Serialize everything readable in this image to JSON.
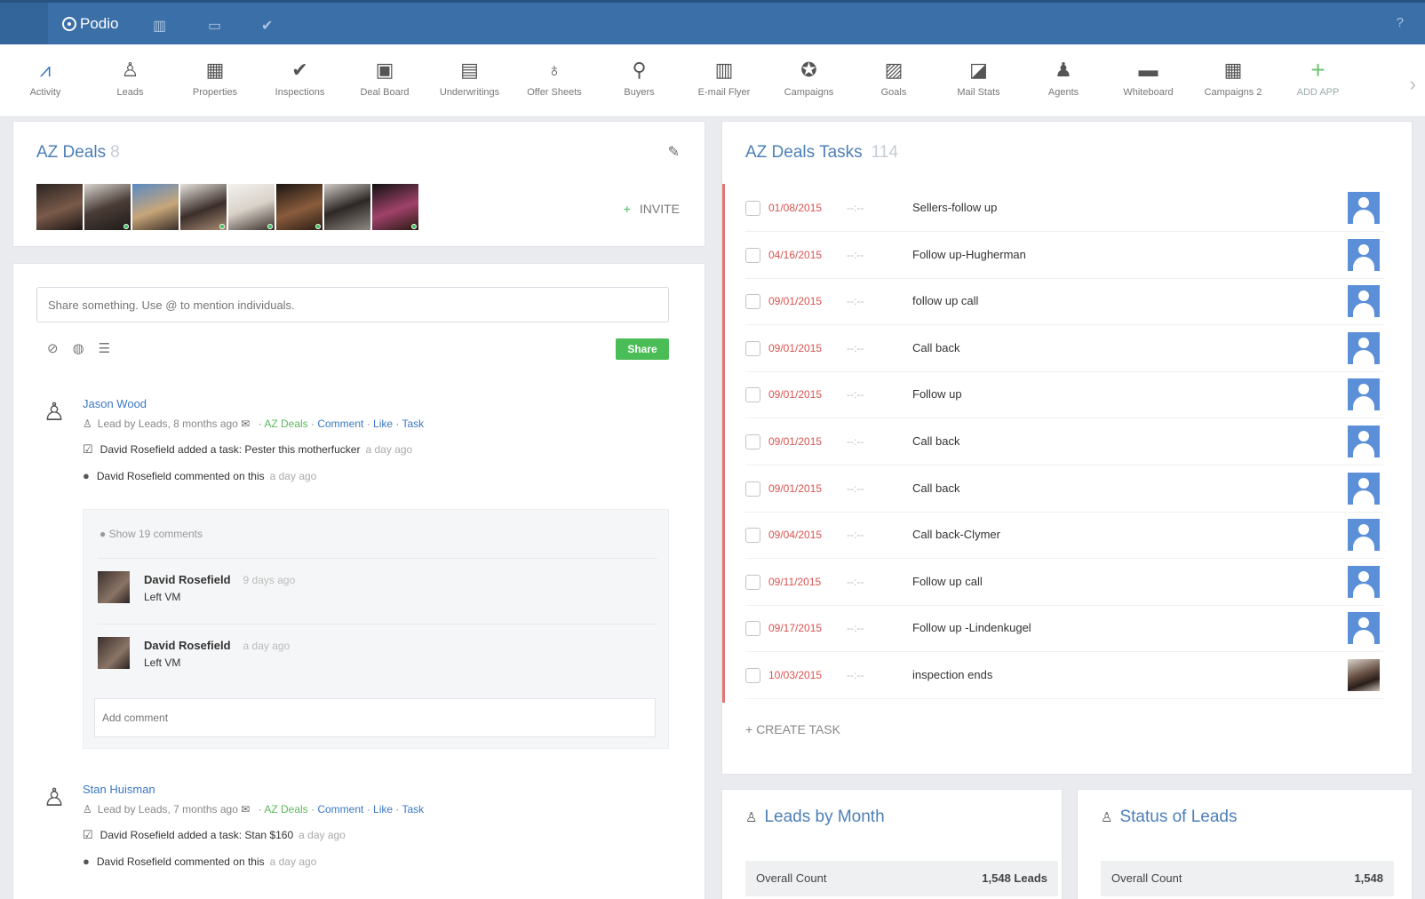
{
  "topbar": {
    "brand": "Podio",
    "icons": [
      "building-icon",
      "calendar-icon",
      "check-icon"
    ],
    "help": "?"
  },
  "apps": [
    {
      "label": "Activity",
      "icon": "activity-icon",
      "glyph": "⩘"
    },
    {
      "label": "Leads",
      "icon": "lead-icon",
      "glyph": "♙"
    },
    {
      "label": "Properties",
      "icon": "properties-icon",
      "glyph": "▦"
    },
    {
      "label": "Inspections",
      "icon": "checkmark-icon",
      "glyph": "✔"
    },
    {
      "label": "Deal Board",
      "icon": "deal-board-icon",
      "glyph": "▣"
    },
    {
      "label": "Underwritings",
      "icon": "underwritings-icon",
      "glyph": "▤"
    },
    {
      "label": "Offer Sheets",
      "icon": "money-bag-icon",
      "glyph": "♁"
    },
    {
      "label": "Buyers",
      "icon": "key-icon",
      "glyph": "⚲"
    },
    {
      "label": "E-mail Flyer",
      "icon": "flyer-icon",
      "glyph": "▥"
    },
    {
      "label": "Campaigns",
      "icon": "campaigns-icon",
      "glyph": "✪"
    },
    {
      "label": "Goals",
      "icon": "goals-chart-icon",
      "glyph": "▨"
    },
    {
      "label": "Mail Stats",
      "icon": "mail-stats-icon",
      "glyph": "◪"
    },
    {
      "label": "Agents",
      "icon": "agent-icon",
      "glyph": "♟"
    },
    {
      "label": "Whiteboard",
      "icon": "whiteboard-icon",
      "glyph": "▬"
    },
    {
      "label": "Campaigns 2",
      "icon": "campaigns-2-icon",
      "glyph": "▦"
    },
    {
      "label": "ADD APP",
      "icon": "add-icon",
      "glyph": "+"
    }
  ],
  "workspace": {
    "title": "AZ Deals",
    "count": "8",
    "invite_label": "INVITE",
    "members": [
      {
        "bg": "linear-gradient(160deg,#2a2320,#7a5a4a 55%,#1c1614)"
      },
      {
        "bg": "linear-gradient(160deg,#d8d4cf,#4a3c36 50%,#1d1a19)"
      },
      {
        "bg": "linear-gradient(160deg,#5a8ac4,#c7a67a 55%,#3a2e28)"
      },
      {
        "bg": "linear-gradient(160deg,#e6e2dc,#3b2e2a 55%,#a88c74)"
      },
      {
        "bg": "linear-gradient(160deg,#f3f1ee,#d9d2c9 50%,#3a302b)"
      },
      {
        "bg": "linear-gradient(160deg,#1b1512,#8a5c3c 55%,#2a1d16)"
      },
      {
        "bg": "linear-gradient(160deg,#cfcac4,#2d2825 50%,#8e8882)"
      },
      {
        "bg": "linear-gradient(160deg,#111,#a0426a 55%,#2a1a12)"
      }
    ]
  },
  "activity": {
    "share_placeholder": "Share something. Use @ to mention individuals.",
    "share_button": "Share",
    "posts": [
      {
        "author": "Jason Wood",
        "meta_prefix": "Lead by Leads, 8 months ago",
        "workspace": "AZ Deals",
        "comment": "Comment",
        "like": "Like",
        "task": "Task",
        "activity1": "David Rosefield added a task: Pester this motherfucker",
        "activity1_ago": "a day ago",
        "activity2": "David Rosefield commented on this",
        "activity2_ago": "a day ago"
      },
      {
        "author": "Stan Huisman",
        "meta_prefix": "Lead by Leads, 7 months ago",
        "workspace": "AZ Deals",
        "comment": "Comment",
        "like": "Like",
        "task": "Task",
        "activity1": "David Rosefield added a task: Stan $160",
        "activity1_ago": "a day ago",
        "activity2": "David Rosefield commented on this",
        "activity2_ago": "a day ago"
      }
    ],
    "show_comments": "Show 19 comments",
    "comments": [
      {
        "name": "David Rosefield",
        "time": "9 days ago",
        "text": "Left VM"
      },
      {
        "name": "David Rosefield",
        "time": "a day ago",
        "text": "Left VM"
      }
    ],
    "add_comment_placeholder": "Add comment"
  },
  "tasks": {
    "title": "AZ Deals Tasks",
    "count": "114",
    "time_placeholder": "--:--",
    "items": [
      {
        "date": "01/08/2015",
        "title": "Sellers-follow up"
      },
      {
        "date": "04/16/2015",
        "title": "Follow up-Hugherman"
      },
      {
        "date": "09/01/2015",
        "title": "follow up call"
      },
      {
        "date": "09/01/2015",
        "title": "Call back"
      },
      {
        "date": "09/01/2015",
        "title": "Follow up"
      },
      {
        "date": "09/01/2015",
        "title": "Call back"
      },
      {
        "date": "09/01/2015",
        "title": "Call back"
      },
      {
        "date": "09/04/2015",
        "title": "Call back-Clymer"
      },
      {
        "date": "09/11/2015",
        "title": "Follow up call"
      },
      {
        "date": "09/17/2015",
        "title": "Follow up -Lindenkugel"
      },
      {
        "date": "10/03/2015",
        "title": "inspection ends"
      }
    ],
    "create_label": "+ CREATE TASK"
  },
  "widgets": [
    {
      "title": "Leads by Month",
      "row_label": "Overall Count",
      "row_value": "1,548 Leads"
    },
    {
      "title": "Status of Leads",
      "row_label": "Overall Count",
      "row_value": "1,548"
    }
  ]
}
